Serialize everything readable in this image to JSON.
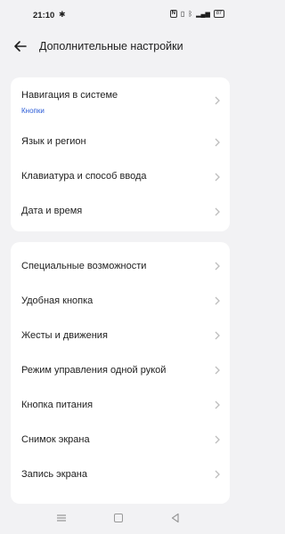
{
  "status": {
    "time": "21:10",
    "nfc": "N",
    "signal_text": "⁴ᴳ",
    "battery": "87"
  },
  "header": {
    "title": "Дополнительные настройки"
  },
  "group1": [
    {
      "label": "Навигация в системе",
      "sub": "Кнопки"
    },
    {
      "label": "Язык и регион"
    },
    {
      "label": "Клавиатура и способ ввода"
    },
    {
      "label": "Дата и время"
    }
  ],
  "group2": [
    {
      "label": "Специальные возможности"
    },
    {
      "label": "Удобная кнопка"
    },
    {
      "label": "Жесты и движения"
    },
    {
      "label": "Режим управления одной рукой"
    },
    {
      "label": "Кнопка питания"
    },
    {
      "label": "Снимок экрана"
    },
    {
      "label": "Запись экрана"
    }
  ],
  "icons": {
    "settings": "gear-icon",
    "back": "arrow-left-icon",
    "chevron": "chevron-right-icon",
    "nav_menu": "menu-icon",
    "nav_home": "square-home-icon",
    "nav_back": "triangle-back-icon"
  },
  "colors": {
    "accent": "#2a5bd7",
    "background": "#f2f2f4",
    "card": "#ffffff"
  }
}
